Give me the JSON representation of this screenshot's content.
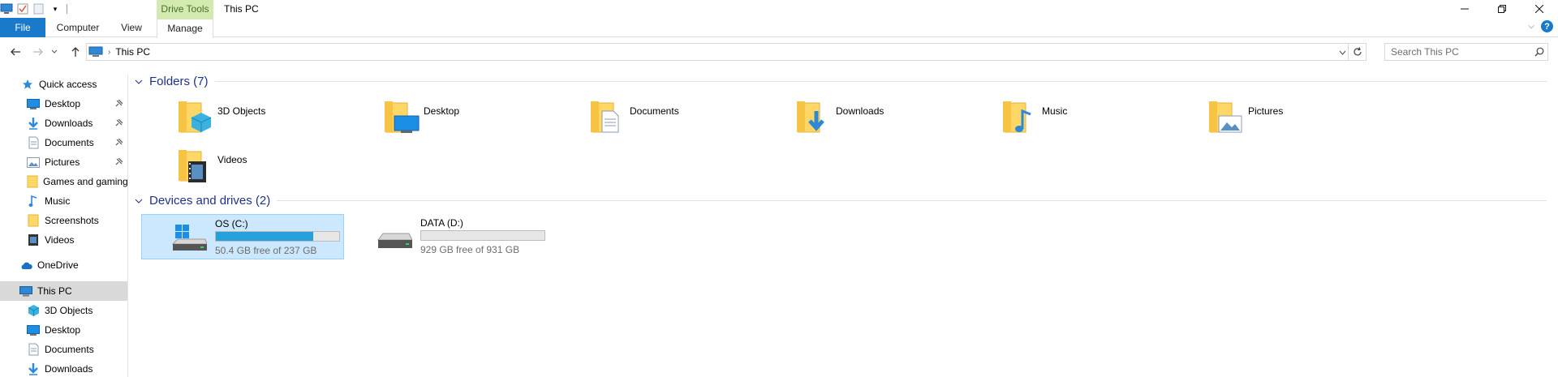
{
  "window": {
    "title": "This PC",
    "contextual_group": "Drive Tools"
  },
  "ribbon": {
    "tabs": [
      {
        "label": "File"
      },
      {
        "label": "Computer"
      },
      {
        "label": "View"
      },
      {
        "label": "Manage"
      }
    ]
  },
  "address": {
    "crumb": "This PC",
    "search_placeholder": "Search This PC"
  },
  "navpane": {
    "items": [
      {
        "label": "Quick access",
        "icon": "star-icon"
      },
      {
        "label": "Desktop",
        "icon": "desktop-icon",
        "pinned": true
      },
      {
        "label": "Downloads",
        "icon": "downloads-icon",
        "pinned": true
      },
      {
        "label": "Documents",
        "icon": "documents-icon",
        "pinned": true
      },
      {
        "label": "Pictures",
        "icon": "pictures-icon",
        "pinned": true
      },
      {
        "label": "Games and gaming",
        "icon": "folder-icon"
      },
      {
        "label": "Music",
        "icon": "music-icon"
      },
      {
        "label": "Screenshots",
        "icon": "folder-icon"
      },
      {
        "label": "Videos",
        "icon": "videos-icon"
      },
      {
        "label": "OneDrive",
        "icon": "cloud-icon"
      },
      {
        "label": "This PC",
        "icon": "computer-icon",
        "selected": true
      },
      {
        "label": "3D Objects",
        "icon": "objects3d-icon"
      },
      {
        "label": "Desktop",
        "icon": "desktop-icon"
      },
      {
        "label": "Documents",
        "icon": "documents-icon"
      },
      {
        "label": "Downloads",
        "icon": "downloads-icon"
      }
    ]
  },
  "content": {
    "folders_header": "Folders (7)",
    "folders": [
      {
        "name": "3D Objects",
        "icon": "objects3d-icon"
      },
      {
        "name": "Desktop",
        "icon": "desktop-icon"
      },
      {
        "name": "Documents",
        "icon": "documents-icon"
      },
      {
        "name": "Downloads",
        "icon": "downloads-icon"
      },
      {
        "name": "Music",
        "icon": "music-icon"
      },
      {
        "name": "Pictures",
        "icon": "pictures-icon"
      },
      {
        "name": "Videos",
        "icon": "videos-icon"
      }
    ],
    "drives_header": "Devices and drives (2)",
    "drives": [
      {
        "name": "OS (C:)",
        "free_text": "50.4 GB free of 237 GB",
        "used_fraction": 0.79,
        "selected": true,
        "icon": "windows-drive-icon"
      },
      {
        "name": "DATA (D:)",
        "free_text": "929 GB free of 931 GB",
        "used_fraction": 0.0,
        "selected": false,
        "icon": "hard-drive-icon"
      }
    ]
  },
  "colors": {
    "accent": "#1979ca",
    "selection": "#cce8ff",
    "header_text": "#1e3287",
    "drive_bar": "#26a0da",
    "contextual": "#d2eaaf"
  }
}
